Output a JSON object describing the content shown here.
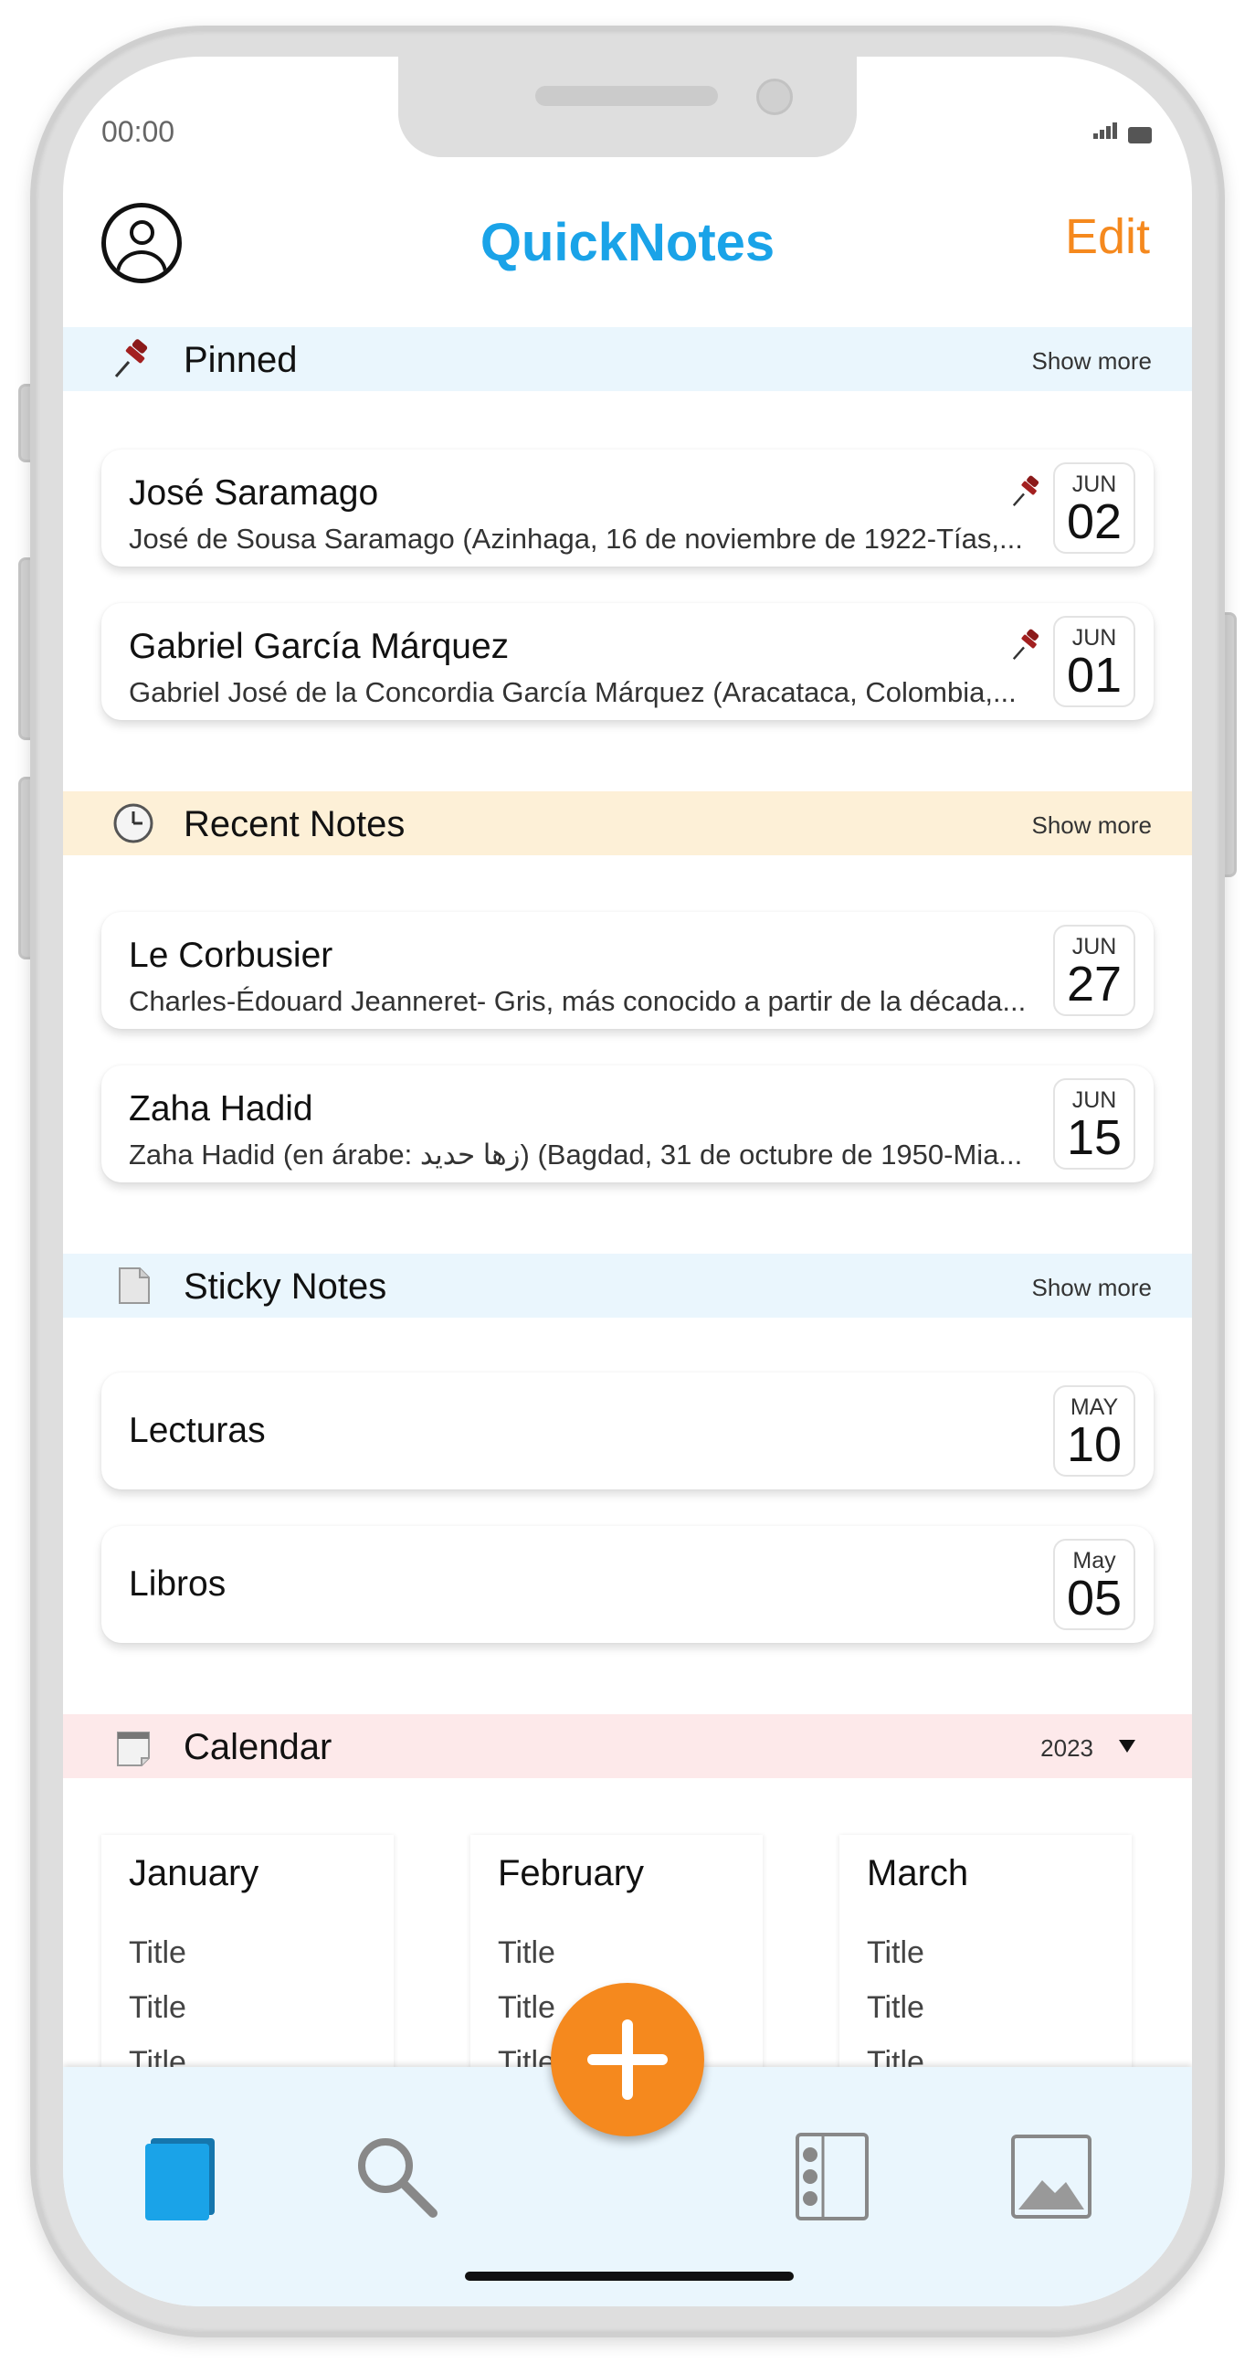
{
  "status": {
    "time": "00:00"
  },
  "header": {
    "title": "QuickNotes",
    "edit_label": "Edit"
  },
  "pinned": {
    "title": "Pinned",
    "show_more": "Show more",
    "notes": [
      {
        "title": "José Saramago",
        "preview": "José de Sousa Saramago (Azinhaga, 16 de noviembre de 1922-Tías,...",
        "month": "JUN",
        "day": "02"
      },
      {
        "title": "Gabriel García Márquez",
        "preview": "Gabriel José de la Concordia García Márquez (Aracataca, Colombia,...",
        "month": "JUN",
        "day": "01"
      }
    ]
  },
  "recent": {
    "title": "Recent Notes",
    "show_more": "Show more",
    "notes": [
      {
        "title": "Le Corbusier",
        "preview": "Charles-Édouard Jeanneret- Gris, más conocido a partir de la década...",
        "month": "JUN",
        "day": "27"
      },
      {
        "title": "Zaha Hadid",
        "preview": "Zaha Hadid (en árabe: زها حديد) (Bagdad, 31 de octubre de 1950-Mia...",
        "month": "JUN",
        "day": "15"
      }
    ]
  },
  "sticky": {
    "title": "Sticky Notes",
    "show_more": "Show more",
    "notes": [
      {
        "title": "Lecturas",
        "month": "MAY",
        "day": "10"
      },
      {
        "title": "Libros",
        "month": "May",
        "day": "05"
      }
    ]
  },
  "calendar": {
    "title": "Calendar",
    "year": "2023",
    "months": [
      {
        "name": "January",
        "items": [
          "Title",
          "Title",
          "Title"
        ]
      },
      {
        "name": "February",
        "items": [
          "Title",
          "Title",
          "Title"
        ]
      },
      {
        "name": "March",
        "items": [
          "Title",
          "Title",
          "Title"
        ]
      }
    ]
  },
  "tabbar": {
    "icons": [
      "notes-icon",
      "search-icon",
      "add-icon",
      "list-icon",
      "image-icon"
    ],
    "active_color": "#1aa3e8",
    "fab_color": "#f5891e"
  },
  "colors": {
    "title_blue": "#1aa3e8",
    "accent_orange": "#f5891e",
    "pin_red": "#8b1a1a"
  }
}
